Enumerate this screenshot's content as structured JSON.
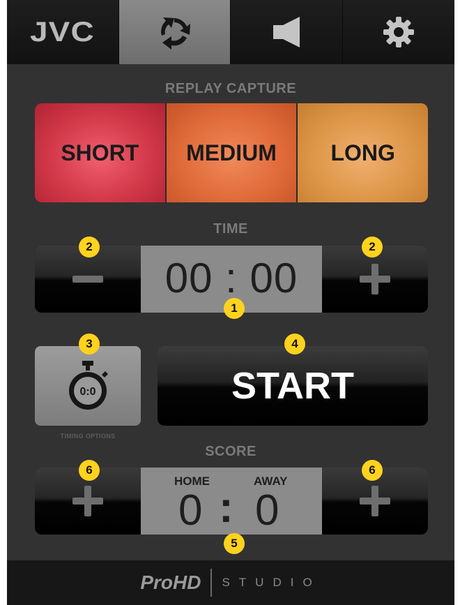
{
  "nav": {
    "brand": "JVC",
    "tabs": [
      {
        "icon": "replay-rotate-icon",
        "active": true
      },
      {
        "icon": "speaker-icon",
        "active": false
      },
      {
        "icon": "gear-icon",
        "active": false
      }
    ]
  },
  "replay": {
    "title": "REPLAY CAPTURE",
    "buttons": [
      "SHORT",
      "MEDIUM",
      "LONG"
    ],
    "colors": {
      "short": "#d23848",
      "medium": "#e06a3a",
      "long": "#dd9648"
    }
  },
  "time": {
    "title": "TIME",
    "value": "00:00",
    "display": "00 : 00"
  },
  "timing": {
    "icon_text": "0:0",
    "label": "TIMING OPTIONS"
  },
  "start": {
    "label": "START"
  },
  "score": {
    "title": "SCORE",
    "home_label": "HOME",
    "away_label": "AWAY",
    "home": "0",
    "away": "0",
    "separator": ":"
  },
  "markers": {
    "time_display": "1",
    "time_minus": "2",
    "time_plus": "2",
    "timing_options": "3",
    "start": "4",
    "score_display": "5",
    "score_home_plus": "6",
    "score_away_plus": "6"
  },
  "footer": {
    "brand": "ProHD",
    "product": "STUDIO"
  },
  "colors": {
    "marker": "#ffd21e",
    "accent_text": "#ffffff"
  }
}
